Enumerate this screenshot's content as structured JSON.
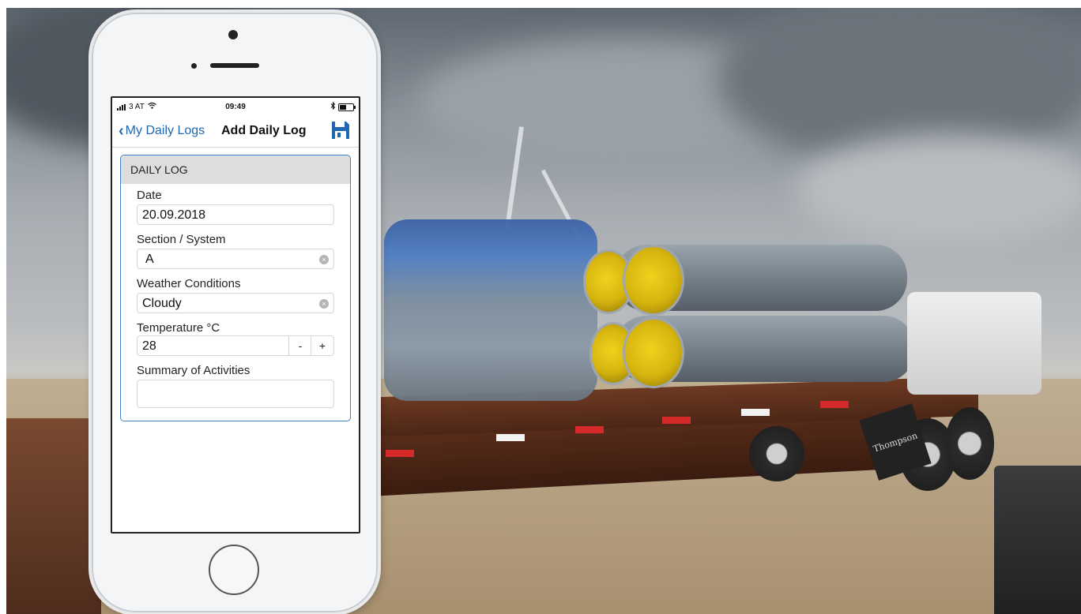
{
  "status_bar": {
    "carrier": "3 AT",
    "time": "09:49"
  },
  "nav": {
    "back_label": "My Daily Logs",
    "title": "Add Daily Log",
    "save_icon": "save-icon"
  },
  "card": {
    "header": "DAILY LOG"
  },
  "fields": {
    "date": {
      "label": "Date",
      "value": "20.09.2018"
    },
    "section": {
      "label": "Section / System",
      "value": "A"
    },
    "weather": {
      "label": "Weather Conditions",
      "value": "Cloudy"
    },
    "temperature": {
      "label": "Temperature °C",
      "value": "28",
      "decrement": "-",
      "increment": "+"
    },
    "summary": {
      "label": "Summary of Activities",
      "value": ""
    }
  },
  "background": {
    "mudflap_text": "Thompson"
  },
  "colors": {
    "accent": "#1f67b3",
    "card_border": "#3a83c6",
    "card_header_bg": "#dddddd"
  }
}
